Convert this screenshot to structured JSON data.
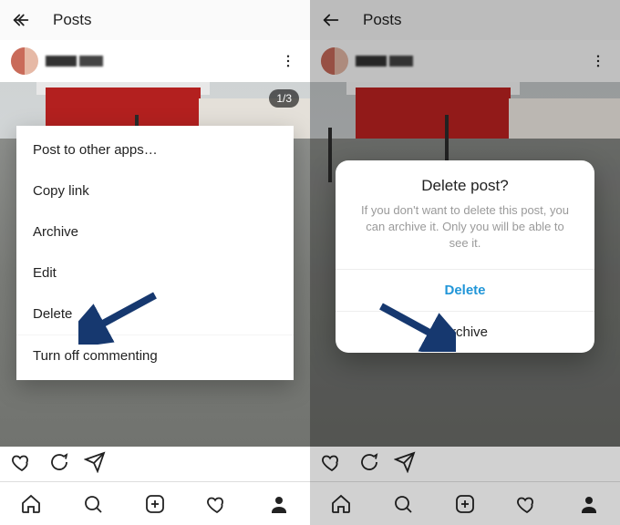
{
  "left": {
    "header": {
      "title": "Posts"
    },
    "photo_counter": "1/3",
    "menu": {
      "items": [
        {
          "label": "Post to other apps…"
        },
        {
          "label": "Copy link"
        },
        {
          "label": "Archive"
        },
        {
          "label": "Edit"
        },
        {
          "label": "Delete"
        },
        {
          "label": "Turn off commenting"
        }
      ]
    }
  },
  "right": {
    "header": {
      "title": "Posts"
    },
    "dialog": {
      "title": "Delete post?",
      "message": "If you don't want to delete this post, you can archive it. Only you will be able to see it.",
      "primary_label": "Delete",
      "secondary_label": "Archive"
    }
  },
  "colors": {
    "arrow": "#16386f"
  }
}
